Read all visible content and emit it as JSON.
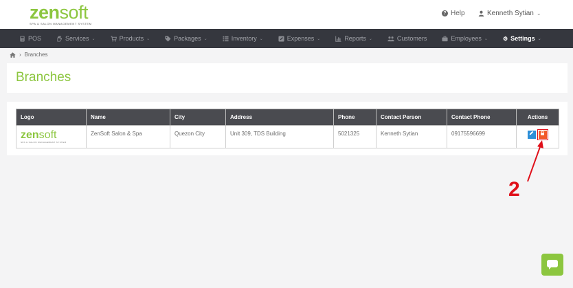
{
  "header": {
    "logo": {
      "brand_a": "zen",
      "brand_b": "soft",
      "tagline": "Spa & Salon Management System"
    },
    "help_label": "Help",
    "user_name": "Kenneth Sytian"
  },
  "nav": {
    "items": [
      {
        "label": "POS",
        "icon": "pos-icon",
        "dropdown": false,
        "active": false
      },
      {
        "label": "Services",
        "icon": "services-icon",
        "dropdown": true,
        "active": false
      },
      {
        "label": "Products",
        "icon": "cart-icon",
        "dropdown": true,
        "active": false
      },
      {
        "label": "Packages",
        "icon": "tag-icon",
        "dropdown": true,
        "active": false
      },
      {
        "label": "Inventory",
        "icon": "list-icon",
        "dropdown": true,
        "active": false
      },
      {
        "label": "Expenses",
        "icon": "pencil-icon",
        "dropdown": true,
        "active": false
      },
      {
        "label": "Reports",
        "icon": "chart-icon",
        "dropdown": true,
        "active": false
      },
      {
        "label": "Customers",
        "icon": "users-icon",
        "dropdown": false,
        "active": false
      },
      {
        "label": "Employees",
        "icon": "briefcase-icon",
        "dropdown": true,
        "active": false
      },
      {
        "label": "Settings",
        "icon": "gear-icon",
        "dropdown": true,
        "active": true
      }
    ]
  },
  "breadcrumb": {
    "current": "Branches"
  },
  "page_title": "Branches",
  "table": {
    "headers": [
      "Logo",
      "Name",
      "City",
      "Address",
      "Phone",
      "Contact Person",
      "Contact Phone",
      "Actions"
    ],
    "rows": [
      {
        "logo": {
          "brand_a": "zen",
          "brand_b": "soft",
          "tagline": "Spa & Salon Management System"
        },
        "name": "ZenSoft Salon & Spa",
        "city": "Quezon City",
        "address": "Unit 309, TDS Building",
        "phone": "5021325",
        "contact_person": "Kenneth Sytian",
        "contact_phone": "09175596699"
      }
    ]
  },
  "annotation": {
    "number": "2",
    "color": "#e0101a"
  },
  "colors": {
    "brand_green": "#8cc63f",
    "nav_bg": "#35373e",
    "edit_blue": "#2d8fd8",
    "lock_orange": "#f25a2a"
  }
}
